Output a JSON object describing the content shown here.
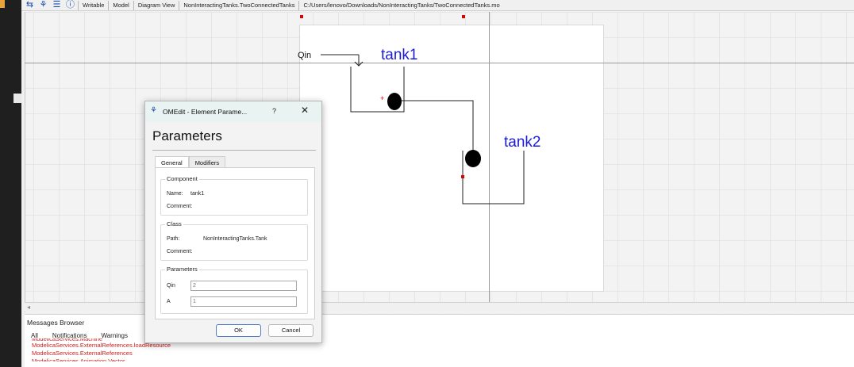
{
  "toolbar": {
    "icons": [
      "connect-mode-icon",
      "element-icon",
      "list-icon",
      "info-icon"
    ],
    "writable": "Writable",
    "type": "Model",
    "view": "Diagram View",
    "model_name": "NonInteractingTanks.TwoConnectedTanks",
    "file_path": "C:/Users/lenovo/Downloads/NonInteractingTanks/TwoConnectedTanks.mo"
  },
  "diagram": {
    "qin_label": "Qin",
    "tank1_label": "tank1",
    "tank2_label": "tank2",
    "tank_label_color": "#1b1bd6",
    "marker_color": "#e00000",
    "plus_marker": "+"
  },
  "dialog": {
    "title": "OMEdit - Element Parame...",
    "help": "?",
    "close": "✕",
    "heading": "Parameters",
    "tabs": [
      "General",
      "Modifiers"
    ],
    "component": {
      "group_title": "Component",
      "name_label": "Name:",
      "name_value": "tank1",
      "comment_label": "Comment:",
      "comment_value": ""
    },
    "class": {
      "group_title": "Class",
      "path_label": "Path:",
      "path_value": "NonInteractingTanks.Tank",
      "comment_label": "Comment:",
      "comment_value": ""
    },
    "parameters": {
      "group_title": "Parameters",
      "qin_label": "Qin",
      "qin_placeholder": "2",
      "a_label": "A",
      "a_placeholder": "1"
    },
    "ok": "OK",
    "cancel": "Cancel"
  },
  "messages": {
    "title": "Messages Browser",
    "tabs": [
      "All",
      "Notifications",
      "Warnings"
    ],
    "lines": [
      "ModelicaServices.Machine",
      "ModelicaServices.ExternalReferences.loadResource",
      "ModelicaServices.ExternalReferences",
      "ModelicaServices.Animation.Vector"
    ],
    "error_color": "#c8201e"
  }
}
